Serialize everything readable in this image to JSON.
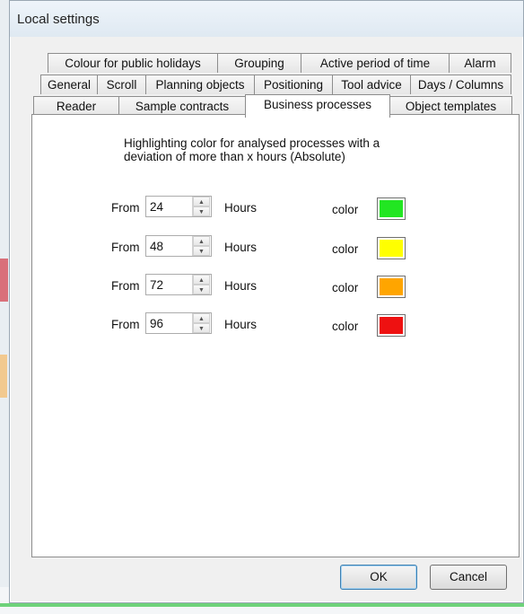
{
  "window": {
    "title": "Local settings"
  },
  "tabs": {
    "row1": [
      "Colour for public holidays",
      "Grouping",
      "Active period of time",
      "Alarm"
    ],
    "row2": [
      "General",
      "Scroll",
      "Planning objects",
      "Positioning",
      "Tool advice",
      "Days / Columns"
    ],
    "row3": [
      "Reader",
      "Sample contracts",
      "Business processes",
      "Object templates"
    ],
    "active": "Business processes"
  },
  "panel": {
    "description": "Highlighting color for analysed processes with a deviation of more than x hours (Absolute)",
    "rows": [
      {
        "from_label": "From",
        "value": "24",
        "unit": "Hours",
        "color_label": "color",
        "color": "#22e622"
      },
      {
        "from_label": "From",
        "value": "48",
        "unit": "Hours",
        "color_label": "color",
        "color": "#ffff00"
      },
      {
        "from_label": "From",
        "value": "72",
        "unit": "Hours",
        "color_label": "color",
        "color": "#ffa500"
      },
      {
        "from_label": "From",
        "value": "96",
        "unit": "Hours",
        "color_label": "color",
        "color": "#ee1111"
      }
    ]
  },
  "buttons": {
    "ok": "OK",
    "cancel": "Cancel"
  },
  "icons": {
    "spin_up": "▲",
    "spin_down": "▼"
  }
}
